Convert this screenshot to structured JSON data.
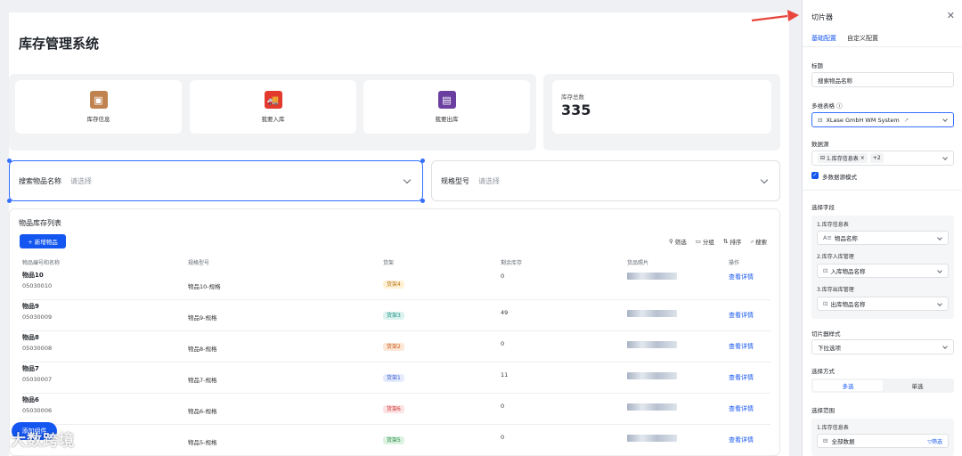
{
  "app": {
    "title": "库存管理系统"
  },
  "cards": [
    {
      "label": "库存信息",
      "icon": "box-icon",
      "color": "#c0834f"
    },
    {
      "label": "我要入库",
      "icon": "truck-icon",
      "color": "#e23b2e"
    },
    {
      "label": "我要出库",
      "icon": "shopping-bag-icon",
      "color": "#6b3fa0"
    }
  ],
  "stat": {
    "label": "库存总数",
    "value": "335"
  },
  "filters": [
    {
      "label": "搜索物品名称",
      "placeholder": "请选择"
    },
    {
      "label": "规格型号",
      "placeholder": "请选择"
    }
  ],
  "table": {
    "title": "物品库存列表",
    "add_label": "+ 新增物品",
    "tools": [
      "筛选",
      "分组",
      "排序",
      "搜索"
    ],
    "columns": [
      "物品编号和名称",
      "规格型号",
      "货架",
      "剩余库存",
      "货品照片",
      "操作"
    ],
    "rows": [
      {
        "name": "物品10",
        "code": "05030010",
        "spec": "物品10-规格",
        "shelf": "货架4",
        "shelf_color": "#fff1d6",
        "shelf_text": "#b8761c",
        "stock": "0",
        "action": "查看详情"
      },
      {
        "name": "物品9",
        "code": "05030009",
        "spec": "物品9-规格",
        "shelf": "货架3",
        "shelf_color": "#dcf3f0",
        "shelf_text": "#1d8f7e",
        "stock": "49",
        "action": "查看详情"
      },
      {
        "name": "物品8",
        "code": "05030008",
        "spec": "物品8-规格",
        "shelf": "货架2",
        "shelf_color": "#fde8d8",
        "shelf_text": "#c45a1c",
        "stock": "0",
        "action": "查看详情"
      },
      {
        "name": "物品7",
        "code": "05030007",
        "spec": "物品7-规格",
        "shelf": "货架1",
        "shelf_color": "#e6ecfd",
        "shelf_text": "#3a5fcd",
        "stock": "11",
        "action": "查看详情"
      },
      {
        "name": "物品6",
        "code": "05030006",
        "spec": "物品6-规格",
        "shelf": "货架6",
        "shelf_color": "#fde3e3",
        "shelf_text": "#c93535",
        "stock": "0",
        "action": "查看详情"
      },
      {
        "name": "",
        "code": "",
        "spec": "物品5-规格",
        "shelf": "货架5",
        "shelf_color": "#ddf3e2",
        "shelf_text": "#2b8a46",
        "stock": "0",
        "action": "查看详情"
      }
    ]
  },
  "fab_label": "添加组件",
  "watermark": "大数跨境",
  "panel": {
    "title": "切片器",
    "tabs": [
      "基础配置",
      "自定义配置"
    ],
    "title_label": "标题",
    "title_value": "搜索物品名称",
    "multi_table_label": "多维表格 ⓘ",
    "multi_table_value": "XLase GmbH WM System",
    "datasource_label": "数据源",
    "datasource_chip": "1.库存信息表",
    "datasource_more": "+2",
    "multi_mode_label": "多数据源模式",
    "field_label": "选择字段",
    "fields": [
      {
        "source": "1.库存信息表",
        "value": "物品名称",
        "prefix": "A≡"
      },
      {
        "source": "2.库存入库管理",
        "value": "入库物品名称",
        "prefix": "⊡"
      },
      {
        "source": "3.库存出库管理",
        "value": "出库物品名称",
        "prefix": "⊡"
      }
    ],
    "style_label": "切片器样式",
    "style_value": "下拉选项",
    "mode_label": "选择方式",
    "modes": [
      "多选",
      "单选"
    ],
    "range_label": "选择范围",
    "range_source": "1.库存信息表",
    "range_value": "全部数据",
    "range_filter": "筛选"
  }
}
